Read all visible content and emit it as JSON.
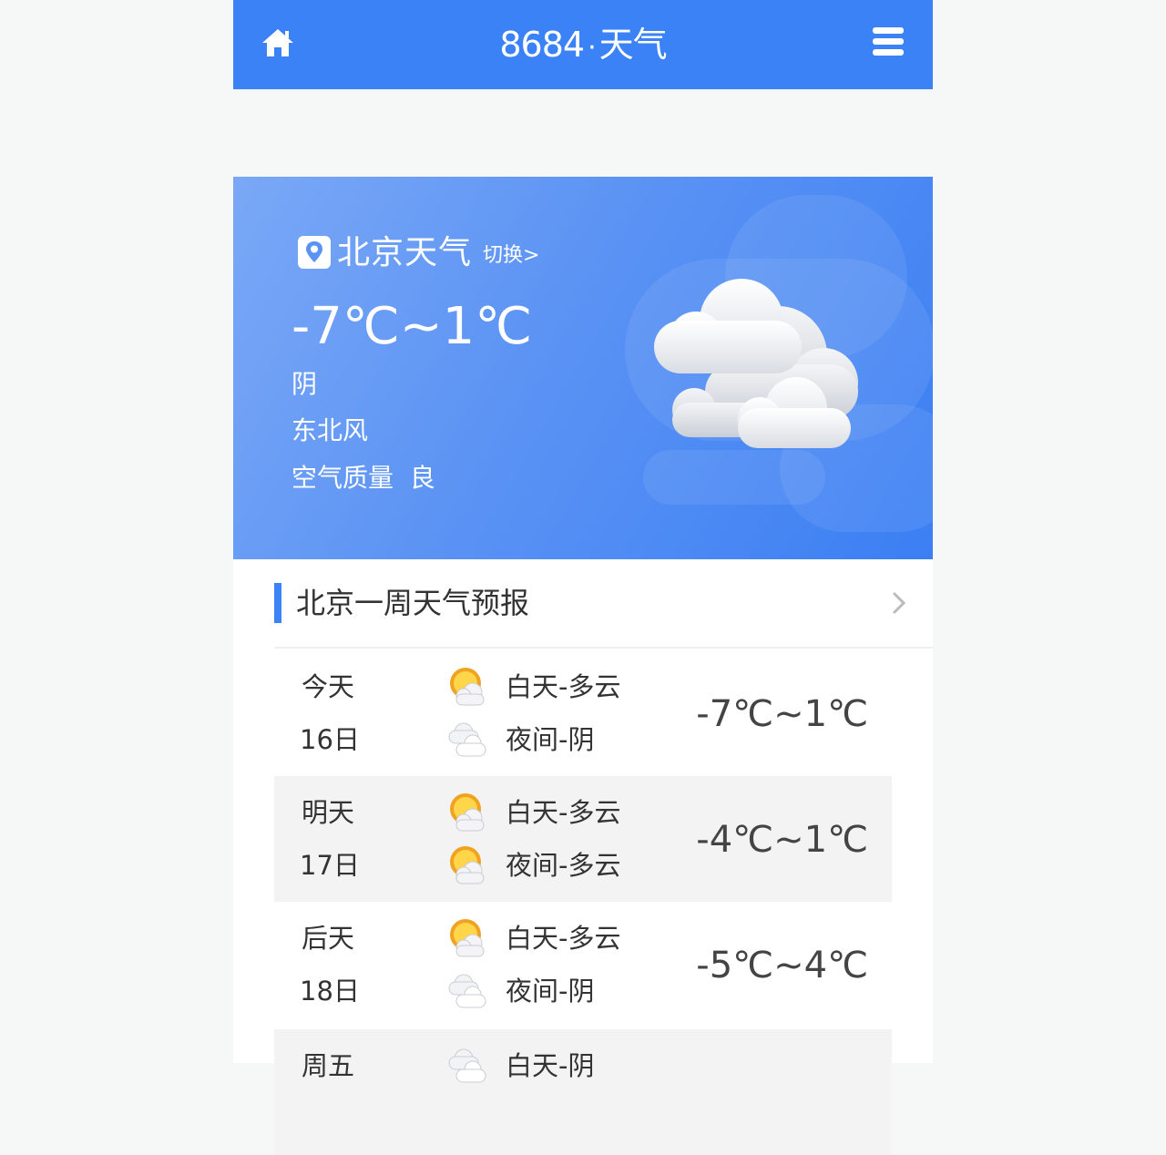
{
  "header": {
    "logo_number": "8684",
    "logo_dot": "·",
    "logo_text": "天气"
  },
  "hero": {
    "city": "北京天气",
    "switch_label": "切换>",
    "temp_range": "-7℃~1℃",
    "condition": "阴",
    "wind": "东北风",
    "air_quality": "空气质量  良",
    "icon": "cloudy-icon"
  },
  "forecast": {
    "title": "北京一周天气预报",
    "days": [
      {
        "name": "今天",
        "date": "16日",
        "day": "白天-多云",
        "night": "夜间-阴",
        "day_icon": "partly-cloudy-icon",
        "night_icon": "overcast-icon",
        "temp": "-7℃~1℃"
      },
      {
        "name": "明天",
        "date": "17日",
        "day": "白天-多云",
        "night": "夜间-多云",
        "day_icon": "partly-cloudy-icon",
        "night_icon": "partly-cloudy-icon",
        "temp": "-4℃~1℃"
      },
      {
        "name": "后天",
        "date": "18日",
        "day": "白天-多云",
        "night": "夜间-阴",
        "day_icon": "partly-cloudy-icon",
        "night_icon": "overcast-icon",
        "temp": "-5℃~4℃"
      },
      {
        "name": "周五",
        "date": "",
        "day": "白天-阴",
        "night": "",
        "day_icon": "overcast-icon",
        "night_icon": "",
        "temp": ""
      }
    ]
  },
  "colors": {
    "brand": "#3a82f6",
    "page_bg": "#f6f7f7",
    "row_shade": "#f3f3f3"
  }
}
